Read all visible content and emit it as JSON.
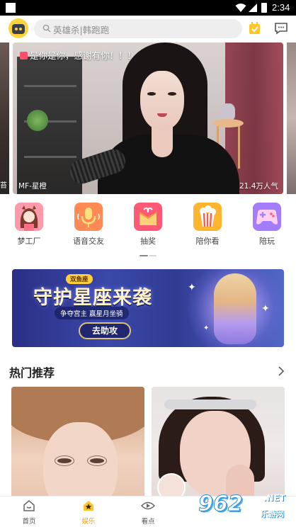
{
  "status_bar": {
    "time": "2:34",
    "icons": [
      "wifi-icon",
      "cell-signal-icon",
      "battery-icon"
    ]
  },
  "header": {
    "search_placeholder": "英雄杀|韩跑跑",
    "icons": [
      "robot-avatar-icon",
      "search-icon",
      "checkin-icon",
      "message-icon"
    ]
  },
  "live": {
    "title": "是你是你，感谢有你！！！",
    "streamer": "MF-星橙",
    "popularity": "21.4万人气",
    "left_peek_label": "苔"
  },
  "categories": [
    {
      "label": "梦工厂",
      "icon": "girl-avatar-icon",
      "color": "#ff8fa0"
    },
    {
      "label": "语音交友",
      "icon": "microphone-icon",
      "color": "#ff7a4d"
    },
    {
      "label": "抽奖",
      "icon": "gift-icon",
      "color": "#ff5570"
    },
    {
      "label": "陪你看",
      "icon": "popcorn-icon",
      "color": "#ffb330"
    },
    {
      "label": "陪玩",
      "icon": "gamepad-icon",
      "color": "#9f7bff"
    }
  ],
  "promo": {
    "badge": "双鱼座",
    "title": "守护星座来袭",
    "subtitle": "争夺宫主  赢星月坐骑",
    "button": "去助攻"
  },
  "section": {
    "title": "热门推荐"
  },
  "bottom_nav": [
    {
      "label": "首页",
      "icon": "home-icon",
      "active": false
    },
    {
      "label": "娱乐",
      "icon": "star-icon",
      "active": true
    },
    {
      "label": "看点",
      "icon": "eye-icon",
      "active": false
    }
  ],
  "watermark": {
    "logo": "962",
    "net": ".NET",
    "cn": "乐游网"
  },
  "colors": {
    "accent": "#f1a300",
    "banner_blue": "#3b48a8"
  }
}
